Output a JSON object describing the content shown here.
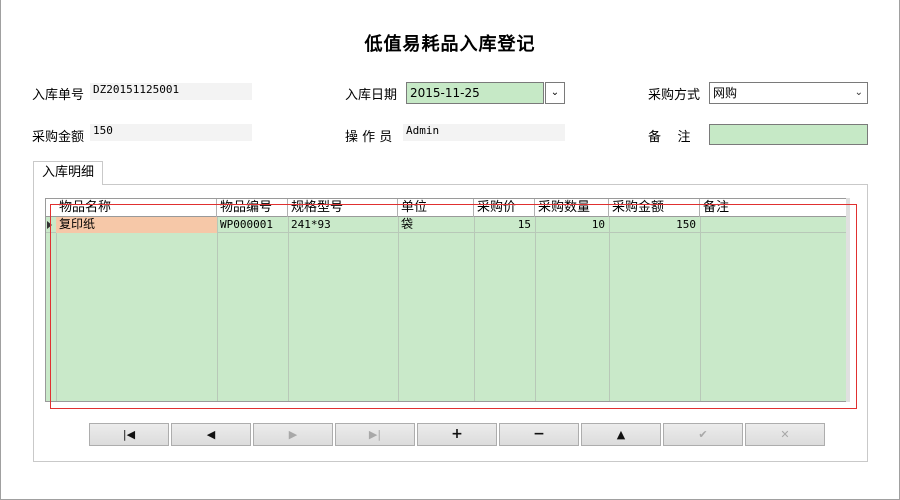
{
  "form": {
    "title": "低值易耗品入库登记",
    "labels": {
      "order_no": "入库单号",
      "date": "入库日期",
      "purchase_method": "采购方式",
      "amount": "采购金额",
      "operator": "操 作 员",
      "remarks": "备    注"
    },
    "values": {
      "order_no": "DZ20151125001",
      "date": "2015-11-25",
      "purchase_method": "网购",
      "amount": "150",
      "operator": "Admin",
      "remarks": ""
    }
  },
  "tab": {
    "label": "入库明细"
  },
  "grid": {
    "columns": [
      "物品名称",
      "物品编号",
      "规格型号",
      "单位",
      "采购价",
      "采购数量",
      "采购金额",
      "备注"
    ],
    "rows": [
      [
        "复印纸",
        "WP000001",
        "241*93",
        "袋",
        "15",
        "10",
        "150",
        ""
      ]
    ]
  },
  "navigator": {
    "buttons": [
      {
        "name": "first",
        "icon": "|◀",
        "enabled": true
      },
      {
        "name": "prior",
        "icon": "◀",
        "enabled": true
      },
      {
        "name": "next",
        "icon": "▶",
        "enabled": false
      },
      {
        "name": "last",
        "icon": "▶|",
        "enabled": false
      },
      {
        "name": "insert",
        "icon": "+",
        "enabled": true
      },
      {
        "name": "delete",
        "icon": "−",
        "enabled": true
      },
      {
        "name": "edit",
        "icon": "▲",
        "enabled": true
      },
      {
        "name": "post",
        "icon": "✔",
        "enabled": false
      },
      {
        "name": "cancel",
        "icon": "✕",
        "enabled": false
      }
    ]
  },
  "colors": {
    "field_green": "#c6e9c6",
    "grid_green": "#c9e9c9",
    "selected_cell": "#f6c8a8",
    "highlight_border": "#e03030"
  }
}
